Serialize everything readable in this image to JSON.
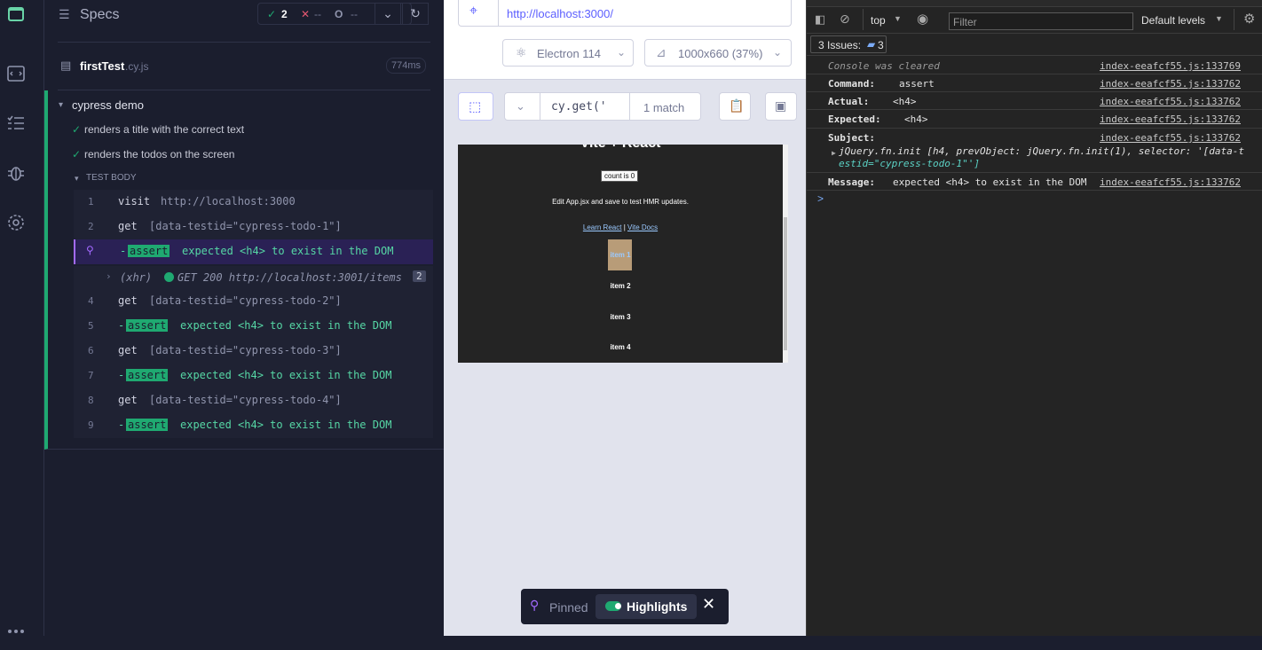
{
  "reporter": {
    "header": {
      "title": "Specs",
      "passed": "2",
      "failed": "--",
      "pending": "--",
      "passed_icon": "✓",
      "failed_icon": "✕",
      "pending_icon": "O"
    },
    "spec": {
      "name": "firstTest",
      "ext": ".cy.js",
      "duration": "774ms"
    },
    "suite": {
      "title": "cypress demo",
      "tests": [
        "renders a title with the correct text",
        "renders the todos on the screen"
      ],
      "test_body": "TEST BODY"
    },
    "commands": [
      {
        "num": "1",
        "name": "visit",
        "msg": "http://localhost:3000"
      },
      {
        "num": "2",
        "name": "get",
        "msg": "[data-testid=\"cypress-todo-1\"]"
      },
      {
        "num": "",
        "name": "-",
        "badge": "assert",
        "msg": "expected <h4> to exist in the DOM"
      },
      {
        "xhr": "(xhr)",
        "msg": "GET 200 http://localhost:3001/items",
        "count": "2"
      },
      {
        "num": "4",
        "name": "get",
        "msg": "[data-testid=\"cypress-todo-2\"]"
      },
      {
        "num": "5",
        "name": "-",
        "badge": "assert",
        "msg": "expected <h4> to exist in the DOM"
      },
      {
        "num": "6",
        "name": "get",
        "msg": "[data-testid=\"cypress-todo-3\"]"
      },
      {
        "num": "7",
        "name": "-",
        "badge": "assert",
        "msg": "expected <h4> to exist in the DOM"
      },
      {
        "num": "8",
        "name": "get",
        "msg": "[data-testid=\"cypress-todo-4\"]"
      },
      {
        "num": "9",
        "name": "-",
        "badge": "assert",
        "msg": "expected <h4> to exist in the DOM"
      }
    ]
  },
  "aut": {
    "url": "http://localhost:3000/",
    "browser": "Electron 114",
    "viewport": "1000x660 (37%)",
    "selector_value": "cy.get('",
    "match_count": "1 match",
    "app": {
      "title": "Vite + React",
      "count": "count is 0",
      "edit_text": "Edit App.jsx and save to test HMR updates.",
      "link_react": "Learn React",
      "link_sep": "|",
      "link_vite": "Vite Docs",
      "items": [
        "item 1",
        "item 2",
        "item 3",
        "item 4"
      ]
    },
    "pinned": {
      "label": "Pinned",
      "highlights": "Highlights"
    }
  },
  "devtools": {
    "context": "top",
    "filter_placeholder": "Filter",
    "levels": "Default levels",
    "issues_label": "3 Issues:",
    "issues_count": "3",
    "console": [
      {
        "type": "cleared",
        "text": "Console was cleared",
        "link": "index-eeafcf55.js:133769"
      },
      {
        "label": "Command:",
        "value": "assert",
        "link": "index-eeafcf55.js:133762"
      },
      {
        "label": "Actual:",
        "value": "<h4>",
        "link": "index-eeafcf55.js:133762"
      },
      {
        "label": "Expected:",
        "value": "<h4>",
        "link": "index-eeafcf55.js:133762"
      },
      {
        "label": "Subject:",
        "value": "",
        "link": "index-eeafcf55.js:133762",
        "line2": "jQuery.fn.init [h4, prevObject: jQuery.fn.init(1), selector: '[data-t",
        "line3": "estid=\"cypress-todo-1\"']"
      },
      {
        "label": "Message:",
        "value": "expected <h4> to exist in the DOM",
        "link": "index-eeafcf55.js:133762"
      }
    ],
    "prompt": ">"
  },
  "colors": {
    "pass": "#1fa971",
    "accent": "#5c5fff",
    "pinned": "#a36aff"
  },
  "icons": [
    "app-logo-icon",
    "specs-icon",
    "runs-icon",
    "debug-icon",
    "settings-icon",
    "checkmark-icon",
    "chevron-down-icon",
    "refresh-icon",
    "crosshair-icon",
    "electron-icon",
    "viewport-icon",
    "selector-icon",
    "copy-icon",
    "open-icon",
    "pin-icon",
    "toggle-icon",
    "close-icon"
  ]
}
